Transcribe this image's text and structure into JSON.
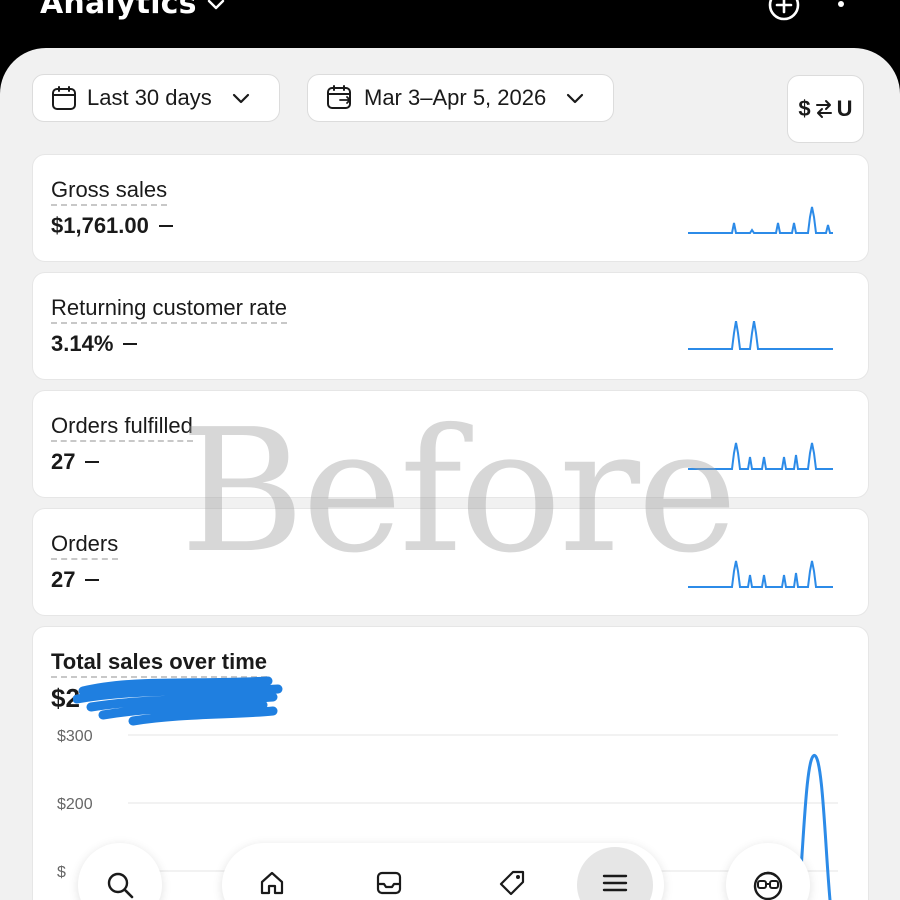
{
  "header": {
    "title": "Analytics",
    "title_menu_icon": "chevron-down-icon",
    "add_icon": "plus-circle-icon",
    "more_icon": "more-vertical-icon"
  },
  "filters": {
    "period": {
      "label": "Last 30 days",
      "icon": "calendar-icon"
    },
    "range": {
      "label": "Mar 3–Apr 5, 2026",
      "icon": "calendar-compare-icon"
    },
    "currency": {
      "label": "$⇄U",
      "symbol": "$",
      "code": "U"
    }
  },
  "metrics": [
    {
      "title": "Gross sales",
      "value": "$1,761.00"
    },
    {
      "title": "Returning customer rate",
      "value": "3.14%"
    },
    {
      "title": "Orders fulfilled",
      "value": "27"
    },
    {
      "title": "Orders",
      "value": "27"
    }
  ],
  "sales_card": {
    "title": "Total sales over time",
    "total_visible": "$2",
    "total_redacted": true
  },
  "chart_data": {
    "type": "line",
    "title": "Total sales over time",
    "y_ticks": [
      "$300",
      "$200",
      "$"
    ],
    "ylim": [
      0,
      300
    ],
    "grid": true,
    "series": [
      {
        "values": [
          0,
          0,
          0,
          0,
          0,
          0,
          0,
          0,
          0,
          0,
          0,
          0,
          0,
          0,
          0,
          0,
          0,
          0,
          0,
          0,
          0,
          0,
          0,
          0,
          0,
          0,
          0,
          0,
          0,
          270,
          0
        ]
      }
    ]
  },
  "watermark": "Before",
  "bottom_nav": {
    "search_icon": "search-icon",
    "items": [
      "home-icon",
      "inbox-icon",
      "tag-icon",
      "menu-icon"
    ],
    "active": "menu-icon",
    "assistant_icon": "sidekick-icon"
  },
  "colors": {
    "accent": "#2c8be8",
    "background": "#f1f1f1",
    "card": "#ffffff",
    "header": "#000000"
  }
}
